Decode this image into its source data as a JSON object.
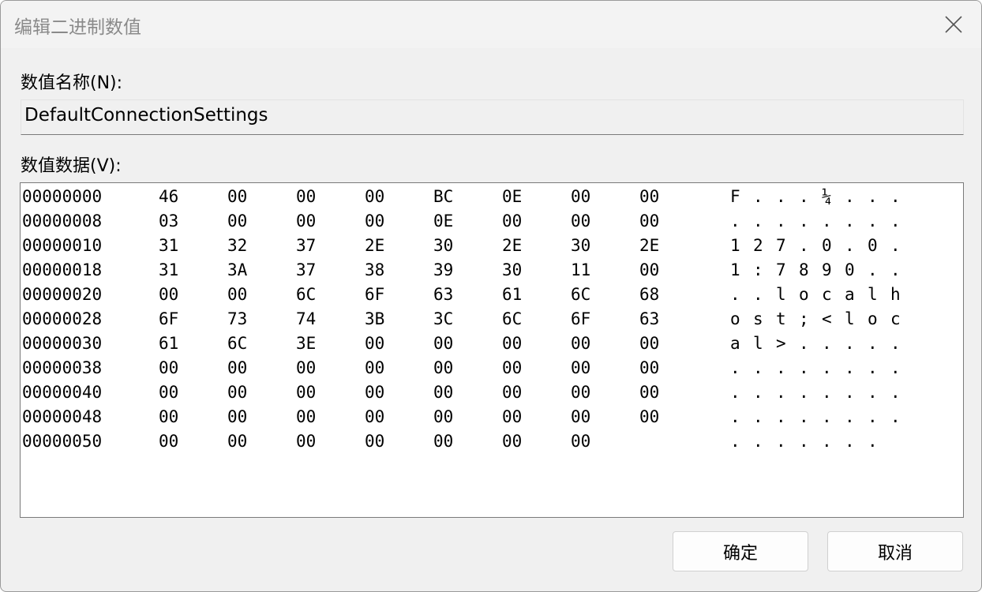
{
  "window": {
    "title": "编辑二进制数值"
  },
  "value_name": {
    "label": "数值名称(N):",
    "value": "DefaultConnectionSettings"
  },
  "value_data": {
    "label": "数值数据(V):",
    "rows": [
      {
        "offset": "00000000",
        "bytes": [
          "46",
          "00",
          "00",
          "00",
          "BC",
          "0E",
          "00",
          "00"
        ],
        "ascii": [
          "F",
          ".",
          ".",
          ".",
          "¼",
          ".",
          ".",
          "."
        ]
      },
      {
        "offset": "00000008",
        "bytes": [
          "03",
          "00",
          "00",
          "00",
          "0E",
          "00",
          "00",
          "00"
        ],
        "ascii": [
          ".",
          ".",
          ".",
          ".",
          ".",
          ".",
          ".",
          "."
        ]
      },
      {
        "offset": "00000010",
        "bytes": [
          "31",
          "32",
          "37",
          "2E",
          "30",
          "2E",
          "30",
          "2E"
        ],
        "ascii": [
          "1",
          "2",
          "7",
          ".",
          "0",
          ".",
          "0",
          "."
        ]
      },
      {
        "offset": "00000018",
        "bytes": [
          "31",
          "3A",
          "37",
          "38",
          "39",
          "30",
          "11",
          "00"
        ],
        "ascii": [
          "1",
          ":",
          "7",
          "8",
          "9",
          "0",
          ".",
          "."
        ]
      },
      {
        "offset": "00000020",
        "bytes": [
          "00",
          "00",
          "6C",
          "6F",
          "63",
          "61",
          "6C",
          "68"
        ],
        "ascii": [
          ".",
          ".",
          "l",
          "o",
          "c",
          "a",
          "l",
          "h"
        ]
      },
      {
        "offset": "00000028",
        "bytes": [
          "6F",
          "73",
          "74",
          "3B",
          "3C",
          "6C",
          "6F",
          "63"
        ],
        "ascii": [
          "o",
          "s",
          "t",
          ";",
          "<",
          "l",
          "o",
          "c"
        ]
      },
      {
        "offset": "00000030",
        "bytes": [
          "61",
          "6C",
          "3E",
          "00",
          "00",
          "00",
          "00",
          "00"
        ],
        "ascii": [
          "a",
          "l",
          ">",
          ".",
          ".",
          ".",
          ".",
          "."
        ]
      },
      {
        "offset": "00000038",
        "bytes": [
          "00",
          "00",
          "00",
          "00",
          "00",
          "00",
          "00",
          "00"
        ],
        "ascii": [
          ".",
          ".",
          ".",
          ".",
          ".",
          ".",
          ".",
          "."
        ]
      },
      {
        "offset": "00000040",
        "bytes": [
          "00",
          "00",
          "00",
          "00",
          "00",
          "00",
          "00",
          "00"
        ],
        "ascii": [
          ".",
          ".",
          ".",
          ".",
          ".",
          ".",
          ".",
          "."
        ]
      },
      {
        "offset": "00000048",
        "bytes": [
          "00",
          "00",
          "00",
          "00",
          "00",
          "00",
          "00",
          "00"
        ],
        "ascii": [
          ".",
          ".",
          ".",
          ".",
          ".",
          ".",
          ".",
          "."
        ]
      },
      {
        "offset": "00000050",
        "bytes": [
          "00",
          "00",
          "00",
          "00",
          "00",
          "00",
          "00"
        ],
        "ascii": [
          ".",
          ".",
          ".",
          ".",
          ".",
          ".",
          "."
        ]
      }
    ]
  },
  "buttons": {
    "ok": "确定",
    "cancel": "取消"
  },
  "icons": {
    "close": "close-icon"
  }
}
